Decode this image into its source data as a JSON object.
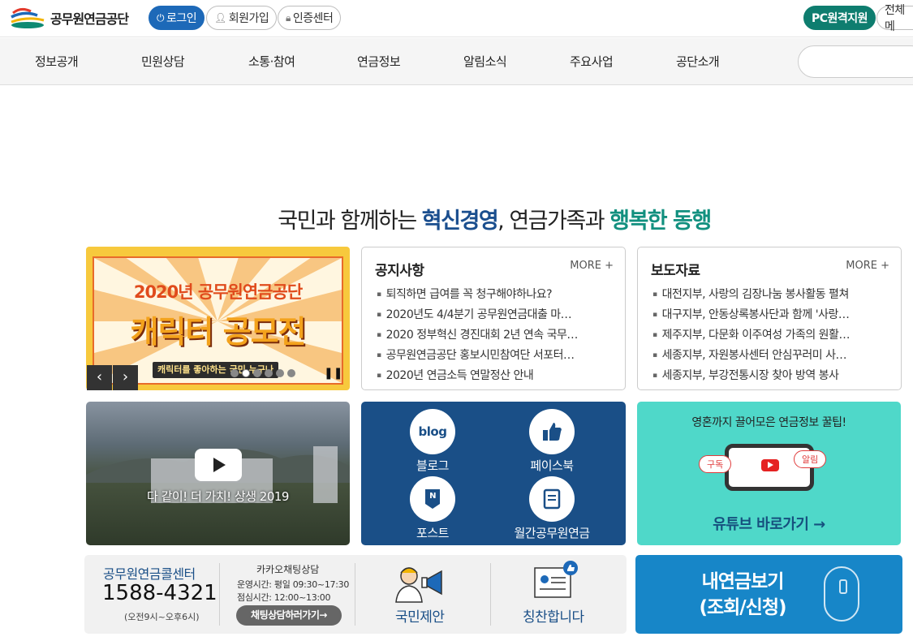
{
  "header": {
    "logo_text": "공무원연금공단",
    "login": "로그인",
    "signup": "회원가입",
    "cert": "인증센터",
    "pc_remote": "PC원격지원",
    "all_menu": "전체메"
  },
  "nav": {
    "items": [
      "정보공개",
      "민원상담",
      "소통·참여",
      "연금정보",
      "알림소식",
      "주요사업",
      "공단소개"
    ]
  },
  "headline": {
    "part1": "국민과 함께하는 ",
    "part2": "혁신경영",
    "part3": ", 연금가족과 ",
    "part4": "행복한 동행"
  },
  "banner": {
    "line1": "2020년 공무원연금공단",
    "line2": "캐릭터 공모전",
    "line3": "캐릭터를 좋아하는 국민 누구나",
    "prev": "‹",
    "next": "›",
    "pause": "❚❚"
  },
  "notice": {
    "title": "공지사항",
    "more": "MORE +",
    "items": [
      "퇴직하면 급여를 꼭 청구해야하나요?",
      "2020년도 4/4분기 공무원연금대출 마…",
      "2020 정부혁신 경진대회 2년 연속 국무…",
      "공무원연금공단 홍보시민참여단 서포터…",
      "2020년 연금소득 연말정산 안내"
    ]
  },
  "press": {
    "title": "보도자료",
    "more": "MORE +",
    "items": [
      "대전지부, 사랑의 김장나눔 봉사활동 펼쳐",
      "대구지부, 안동상록봉사단과 함께 '사랑…",
      "제주지부, 다문화 이주여성 가족의 원활…",
      "세종지부, 자원봉사센터 안심꾸러미 사…",
      "세종지부, 부강전통시장 찾아 방역 봉사"
    ]
  },
  "video": {
    "caption": "다 같이! 더 가치! 상생 2019"
  },
  "sns": {
    "blog_icon": "blog",
    "blog": "블로그",
    "facebook": "페이스북",
    "post_icon": "N",
    "post": "포스트",
    "monthly": "월간공무원연금"
  },
  "youtube": {
    "top": "영혼까지 끌어모은 연금정보 꿀팁!",
    "tag_subscribe": "구독",
    "tag_alarm": "알림",
    "link": "유튜브 바로가기 →"
  },
  "contact": {
    "call_label": "공무원연금콜센터",
    "call_number": "1588-4321",
    "call_hours": "(오전9시~오후6시)",
    "kakao_title": "카카오채팅상담",
    "kakao_hours": "운영시간: 평일 09:30~17:30",
    "kakao_lunch": "점심시간: 12:00~13:00",
    "kakao_button": "채팅상담하러가기→",
    "proposal": "국민제안",
    "praise": "칭찬합니다"
  },
  "mypension": {
    "line1": "내연금보기",
    "line2": "(조회/신청)"
  },
  "colors": {
    "primary_blue": "#1d69b8",
    "teal": "#0e7d6f",
    "navy": "#1a4f87",
    "youtube_bg": "#4fd8c9"
  }
}
